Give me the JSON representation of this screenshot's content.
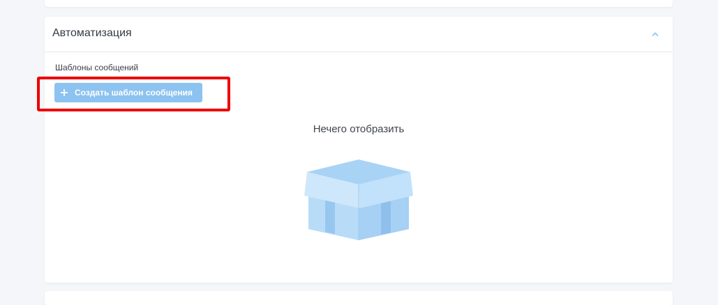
{
  "section": {
    "title": "Автоматизация",
    "collapse_icon": "chevron-up-icon"
  },
  "templates": {
    "label": "Шаблоны сообщений",
    "create_button_label": "Создать шаблон сообщения",
    "create_button_icon": "plus-icon"
  },
  "empty_state": {
    "text": "Нечего отобразить",
    "illustration": "empty-box-icon"
  },
  "colors": {
    "accent": "#8cc3f0",
    "highlight": "#ee0000",
    "page_background": "#f4f6f9"
  }
}
